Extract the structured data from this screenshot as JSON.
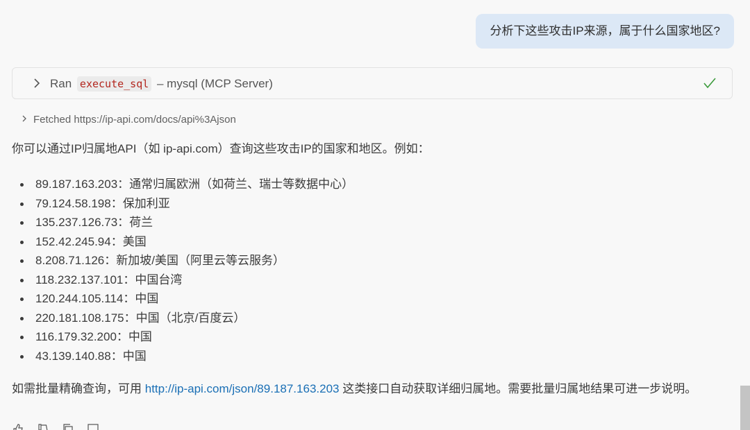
{
  "user_message": "分析下这些攻击IP来源，属于什么国家地区?",
  "tool_call": {
    "prefix": "Ran",
    "tool_name": "execute_sql",
    "suffix": "– mysql (MCP Server)",
    "status_icon": "check-icon"
  },
  "fetched": {
    "label": "Fetched https://ip-api.com/docs/api%3Ajson"
  },
  "response": {
    "intro": "你可以通过IP归属地API（如 ip-api.com）查询这些攻击IP的国家和地区。例如：",
    "items": [
      "89.187.163.203：通常归属欧洲（如荷兰、瑞士等数据中心）",
      "79.124.58.198：保加利亚",
      "135.237.126.73：荷兰",
      "152.42.245.94：美国",
      "8.208.71.126：新加坡/美国（阿里云等云服务）",
      "118.232.137.101：中国台湾",
      "120.244.105.114：中国",
      "220.181.108.175：中国（北京/百度云）",
      "116.179.32.200：中国",
      "43.139.140.88：中国"
    ],
    "footer_before": "如需批量精确查询，可用 ",
    "footer_link": "http://ip-api.com/json/89.187.163.203",
    "footer_after": " 这类接口自动获取详细归属地。需要批量归属地结果可进一步说明。"
  },
  "actions": [
    "thumbs-up-icon",
    "thumbs-down-icon",
    "copy-icon",
    "more-icon"
  ],
  "colors": {
    "background": "#f8f8f8",
    "user_bubble": "#dce8f6",
    "link": "#1a6fb5",
    "code_text": "#b3261e",
    "check": "#3a9a3a"
  }
}
